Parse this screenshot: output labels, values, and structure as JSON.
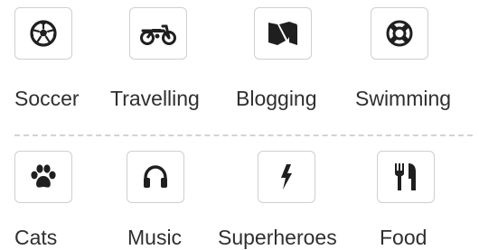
{
  "interests": {
    "row1": [
      {
        "label": "Soccer",
        "icon": "soccer-ball-icon"
      },
      {
        "label": "Travelling",
        "icon": "motorcycle-icon"
      },
      {
        "label": "Blogging",
        "icon": "medium-m-icon"
      },
      {
        "label": "Swimming",
        "icon": "life-ring-icon"
      }
    ],
    "row2": [
      {
        "label": "Cats",
        "icon": "paw-icon"
      },
      {
        "label": "Music",
        "icon": "headphones-icon"
      },
      {
        "label": "Superheroes",
        "icon": "lightning-bolt-icon"
      },
      {
        "label": "Food",
        "icon": "cutlery-icon"
      }
    ]
  },
  "colors": {
    "icon": "#1f1f1f",
    "text": "#2f2f2f",
    "tile_border": "#cfcfcf",
    "divider": "#d3d3d3"
  }
}
